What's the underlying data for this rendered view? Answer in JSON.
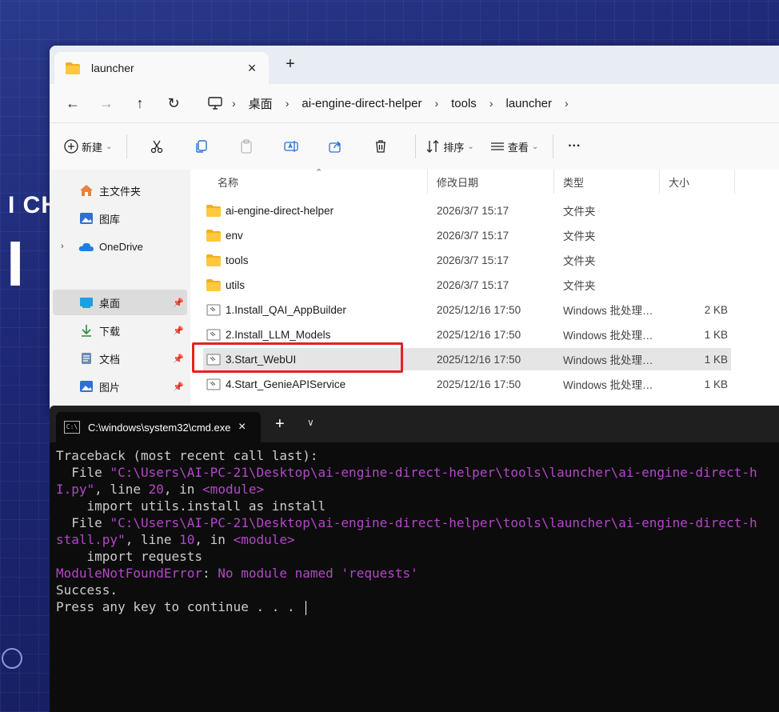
{
  "desktop": {
    "text1": "I CH",
    "text2": "I"
  },
  "explorer": {
    "tab_title": "launcher",
    "tab_close": "×",
    "tab_new": "+",
    "nav": {
      "back": "←",
      "forward": "→",
      "up": "↑",
      "refresh": "↻",
      "more": "›"
    },
    "breadcrumbs": [
      "桌面",
      "ai-engine-direct-helper",
      "tools",
      "launcher"
    ],
    "toolbar": {
      "new_label": "新建",
      "sort_label": "排序",
      "view_label": "查看",
      "more": "···"
    },
    "sidebar": [
      {
        "label": "主文件夹",
        "icon": "home-icon"
      },
      {
        "label": "图库",
        "icon": "gallery-icon"
      },
      {
        "label": "OneDrive",
        "icon": "cloud-icon"
      },
      {
        "label": "桌面",
        "icon": "desktop-icon"
      },
      {
        "label": "下载",
        "icon": "download-icon"
      },
      {
        "label": "文档",
        "icon": "document-icon"
      },
      {
        "label": "图片",
        "icon": "pictures-icon"
      }
    ],
    "columns": {
      "name": "名称",
      "modified": "修改日期",
      "type": "类型",
      "size": "大小"
    },
    "rows": [
      {
        "name": "ai-engine-direct-helper",
        "date": "2026/3/7 15:17",
        "type": "文件夹",
        "size": ""
      },
      {
        "name": "env",
        "date": "2026/3/7 15:17",
        "type": "文件夹",
        "size": ""
      },
      {
        "name": "tools",
        "date": "2026/3/7 15:17",
        "type": "文件夹",
        "size": ""
      },
      {
        "name": "utils",
        "date": "2026/3/7 15:17",
        "type": "文件夹",
        "size": ""
      },
      {
        "name": "1.Install_QAI_AppBuilder",
        "date": "2025/12/16 17:50",
        "type": "Windows 批处理…",
        "size": "2 KB"
      },
      {
        "name": "2.Install_LLM_Models",
        "date": "2025/12/16 17:50",
        "type": "Windows 批处理…",
        "size": "1 KB"
      },
      {
        "name": "3.Start_WebUI",
        "date": "2025/12/16 17:50",
        "type": "Windows 批处理…",
        "size": "1 KB"
      },
      {
        "name": "4.Start_GenieAPIService",
        "date": "2025/12/16 17:50",
        "type": "Windows 批处理…",
        "size": "1 KB"
      }
    ]
  },
  "terminal": {
    "tab_title": "C:\\windows\\system32\\cmd.exe",
    "tab_close": "×",
    "new_tab": "+",
    "dropdown": "∨",
    "lines": {
      "l1": "Traceback (most recent call last):",
      "l2a": "  File ",
      "l2b": "\"C:\\Users\\AI-PC-21\\Desktop\\ai-engine-direct-helper\\tools\\launcher\\ai-engine-direct-h",
      "l3a": "I.py\"",
      "l3b": ", line ",
      "l3c": "20",
      "l3d": ", in ",
      "l3e": "<module>",
      "l4": "    import utils.install as install",
      "l5a": "  File ",
      "l5b": "\"C:\\Users\\AI-PC-21\\Desktop\\ai-engine-direct-helper\\tools\\launcher\\ai-engine-direct-h",
      "l6a": "stall.py\"",
      "l6b": ", line ",
      "l6c": "10",
      "l6d": ", in ",
      "l6e": "<module>",
      "l7": "    import requests",
      "l8a": "ModuleNotFoundError",
      "l8b": ": ",
      "l8c": "No module named 'requests'",
      "l9": "Success.",
      "l10": "Press any key to continue . . . "
    }
  },
  "colors": {
    "highlight_box": "#e52222",
    "terminal_magenta": "#b148c6",
    "folder": "#f2b01e"
  }
}
